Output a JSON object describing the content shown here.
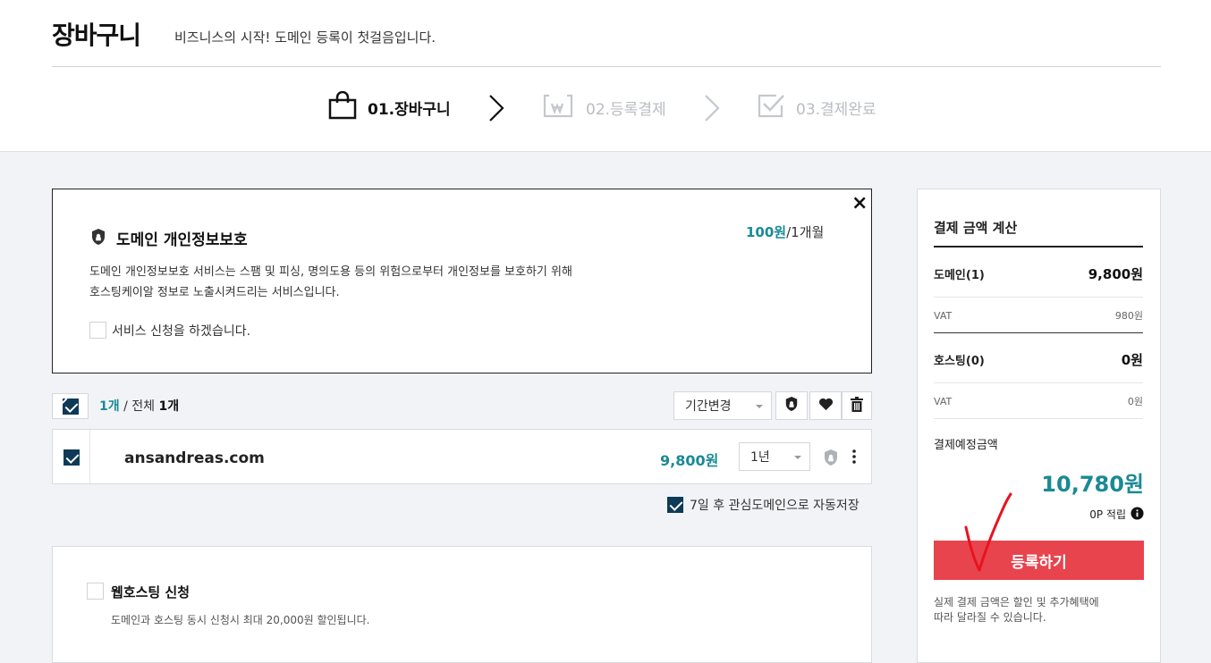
{
  "header": {
    "title": "장바구니",
    "subtitle": "비즈니스의 시작! 도메인 등록이 첫걸음입니다."
  },
  "steps": [
    {
      "label": "01.장바구니",
      "active": true
    },
    {
      "label": "02.등록결제",
      "active": false
    },
    {
      "label": "03.결제완료",
      "active": false
    }
  ],
  "privacy": {
    "title": "도메인 개인정보보호",
    "price": "100원",
    "price_unit": "/1개월",
    "desc_line1": "도메인 개인정보보호 서비스는 스팸 및 피싱, 명의도용 등의 위험으로부터 개인정보를 보호하기 위해",
    "desc_line2": "호스팅케이알 정보로 노출시켜드리는 서비스입니다.",
    "agree_label": "서비스 신청을 하겠습니다.",
    "close": "×"
  },
  "cart_toolbar": {
    "selected": "1개",
    "separator": " / ",
    "total_label": "전체",
    "total": "1개",
    "period_change": "기간변경"
  },
  "cart_items": [
    {
      "domain": "ansandreas.com",
      "price": "9,800원",
      "period": "1년"
    }
  ],
  "autosave_label": "7일 후 관심도메인으로 자동저장",
  "hosting": {
    "title": "웹호스팅 신청",
    "desc": "도메인과 호스팅 동시 신청시 최대 20,000원 할인됩니다."
  },
  "summary": {
    "title": "결제 금액 계산",
    "domain_label": "도메인(1)",
    "domain_value": "9,800원",
    "vat_label_1": "VAT",
    "vat_value_1": "980원",
    "hosting_label": "호스팅(0)",
    "hosting_value": "0원",
    "vat_label_2": "VAT",
    "vat_value_2": "0원",
    "expected_label": "결제예정금액",
    "expected_value": "10,780원",
    "points": "0P 적립",
    "register_button": "등록하기",
    "note_line1": "실제 결제 금액은 할인 및 추가혜택에",
    "note_line2": "따라 달라질 수 있습니다."
  },
  "colors": {
    "accent_teal": "#1a8a94",
    "checkbox_navy": "#0f3a57",
    "register_red": "#e8444e",
    "annotation_red": "#e8131f"
  }
}
